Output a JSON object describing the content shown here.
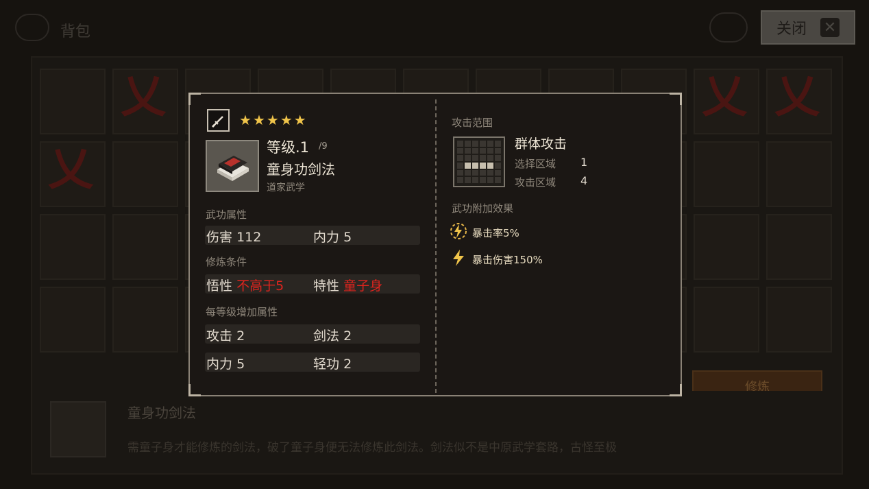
{
  "background": {
    "title": "背包",
    "close_label": "关闭",
    "info_name": "童身功剑法",
    "info_desc": "需童子身才能修炼的剑法，破了童子身便无法修炼此剑法。剑法似不是中原武学套路，古怪至极",
    "train_label": "修炼"
  },
  "card": {
    "stars": [
      "★",
      "★",
      "★",
      "★",
      "★"
    ],
    "level": "等级.1",
    "level_max": "/9",
    "name": "童身功剑法",
    "school": "道家武学",
    "attr_title": "武功属性",
    "damage_label": "伤害",
    "damage_value": "112",
    "inner_label": "内力",
    "inner_value": "5",
    "req_title": "修炼条件",
    "comprehension_label": "悟性",
    "comprehension_value": "不高于5",
    "trait_label": "特性",
    "trait_value": "童子身",
    "per_level_title": "每等级增加属性",
    "atk_label": "攻击",
    "atk_value": "2",
    "sword_label": "剑法",
    "sword_value": "2",
    "inner2_label": "内力",
    "inner2_value": "5",
    "qinggong_label": "轻功",
    "qinggong_value": "2",
    "range_title": "攻击范围",
    "attack_type": "群体攻击",
    "select_area_label": "选择区域",
    "select_area_value": "1",
    "attack_area_label": "攻击区域",
    "attack_area_value": "4",
    "effects_title": "武功附加效果",
    "effect1": "暴击率5%",
    "effect2": "暴击伤害150%"
  },
  "colors": {
    "accent_red": "#e0241e",
    "star_gold": "#f0c44a"
  },
  "icons": {
    "weapon": "sword-icon",
    "book": "book-icon",
    "close": "close-icon"
  }
}
